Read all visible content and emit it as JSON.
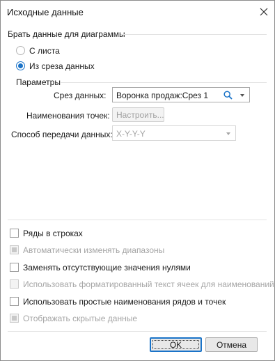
{
  "dialog": {
    "title": "Исходные данные"
  },
  "source_group": {
    "label": "Брать данные для диаграммы",
    "options": [
      {
        "label": "С листа",
        "checked": false
      },
      {
        "label": "Из среза данных",
        "checked": true
      }
    ]
  },
  "params": {
    "label": "Параметры",
    "slice_label": "Срез данных:",
    "slice_value": "Воронка продаж:Срез 1",
    "points_label": "Наименования точек:",
    "configure_button": "Настроить...",
    "transfer_label": "Способ передачи данных:",
    "transfer_value": "X-Y-Y-Y"
  },
  "options": [
    {
      "label": "Ряды в строках",
      "checked": false,
      "enabled": true
    },
    {
      "label": "Автоматически изменять диапазоны",
      "checked": true,
      "enabled": false
    },
    {
      "label": "Заменять отсутствующие значения нулями",
      "checked": false,
      "enabled": true
    },
    {
      "label": "Использовать форматированный текст ячеек для наименований",
      "checked": false,
      "enabled": false
    },
    {
      "label": "Использовать простые наименования рядов и точек",
      "checked": false,
      "enabled": true
    },
    {
      "label": "Отображать скрытые данные",
      "checked": true,
      "enabled": false
    }
  ],
  "footer": {
    "ok_label": "OK",
    "cancel_label": "Отмена"
  },
  "colors": {
    "accent": "#1a73c8",
    "disabled_text": "#a5a5a5",
    "border": "#8c8c8c"
  },
  "icons": {
    "close": "close-icon",
    "search": "search-icon",
    "dropdown": "chevron-down-icon"
  }
}
